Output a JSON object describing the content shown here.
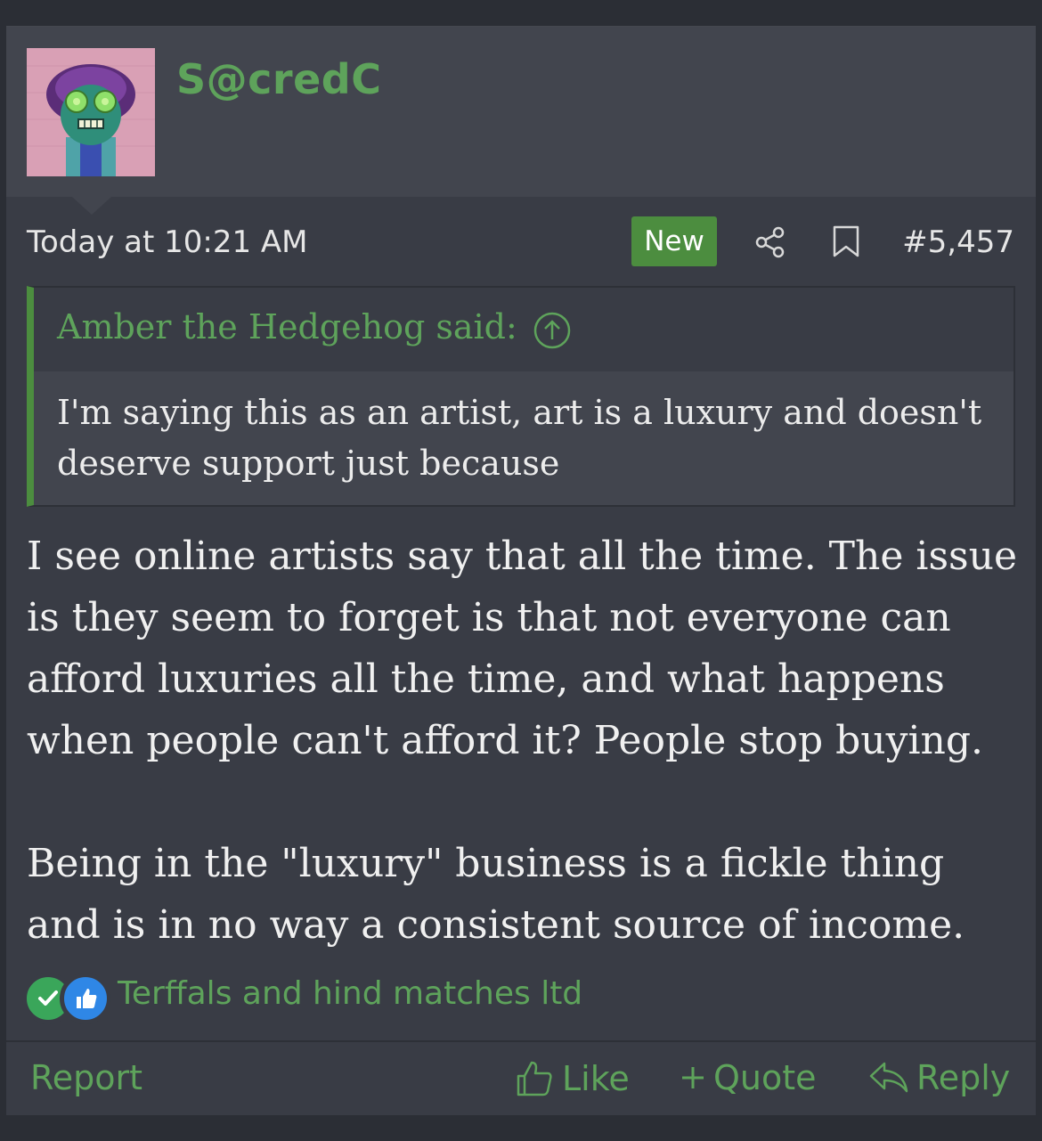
{
  "post": {
    "username": "S@credC",
    "time": "Today at 10:21 AM",
    "badge": "New",
    "number": "#5,457",
    "quote": {
      "author": "Amber the Hedgehog said:",
      "text": "I'm saying this as an artist, art is a luxury and doesn't deserve support just because"
    },
    "body": {
      "paragraph1": "I see online artists say that all the time. The issue is they seem to forget is that not everyone can afford luxuries all the time, and what happens when people can't afford it? People stop buying.",
      "paragraph2": "Being in the \"luxury\" business is a fickle thing and is in no way a consistent source of income."
    },
    "reactions": {
      "names": "Terffals and hind matches ltd",
      "icons": [
        "check-reaction-icon",
        "like-reaction-icon"
      ]
    },
    "footer": {
      "report": "Report",
      "like": "Like",
      "quote": "Quote",
      "reply": "Reply"
    }
  },
  "colors": {
    "accent": "#5ea35b",
    "badge": "#4c8d3f",
    "background": "#393c45",
    "header": "#42454e"
  }
}
